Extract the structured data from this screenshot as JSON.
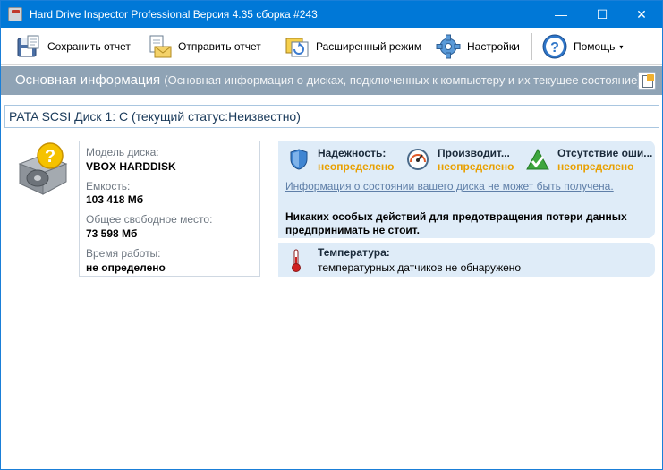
{
  "window": {
    "title": "Hard Drive Inspector Professional Версия 4.35 сборка #243",
    "minimize": "—",
    "maximize": "☐",
    "close": "✕"
  },
  "toolbar": {
    "save_report": "Сохранить отчет",
    "send_report": "Отправить отчет",
    "advanced_mode": "Расширенный режим",
    "settings": "Настройки",
    "help": "Помощь",
    "help_chevron": "▾"
  },
  "section": {
    "title": "Основная информация",
    "subtitle": "(Основная информация о дисках, подключенных к компьютеру и  их текущее состояние)"
  },
  "disk": {
    "title": "PATA SCSI Диск 1: C (текущий статус:Неизвестно)",
    "model_label": "Модель диска:",
    "model_value": "VBOX HARDDISK",
    "capacity_label": "Емкость:",
    "capacity_value": "103 418 Мб",
    "free_label": "Общее свободное место:",
    "free_value": "73 598 Мб",
    "uptime_label": "Время работы:",
    "uptime_value": "не определено"
  },
  "status": {
    "reliability_label": "Надежность:",
    "reliability_value": "неопределено",
    "performance_label": "Производит...",
    "performance_value": "неопределено",
    "errors_label": "Отсутствие оши...",
    "errors_value": "неопределено",
    "info_link": "Информация о состоянии вашего диска не может быть получена.",
    "advice": "Никаких особых действий для предотвращения потери данных предпринимать не стоит."
  },
  "temperature": {
    "label": "Температура:",
    "value": "температурных датчиков не обнаружено"
  },
  "colors": {
    "titlebar": "#0078d7",
    "section_header": "#8fa3b5",
    "status_bg": "#dfecf8",
    "warning_value": "#e8a000"
  }
}
